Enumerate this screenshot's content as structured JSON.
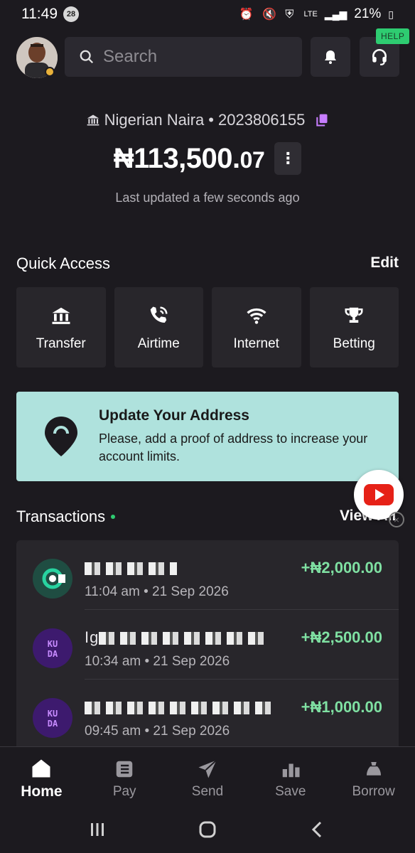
{
  "status_bar": {
    "time": "11:49",
    "notification_count": "28",
    "network": "LTE",
    "battery": "21%",
    "icons": [
      "alarm-icon",
      "mute-icon",
      "battery-saver-icon",
      "lte-icon",
      "signal-icon",
      "battery-icon"
    ]
  },
  "header": {
    "search_placeholder": "Search",
    "help_tag": "HELP"
  },
  "account": {
    "currency": "Nigerian Naira",
    "separator": "•",
    "number": "2023806155",
    "balance_main": "₦113,500.",
    "balance_decimal": "07",
    "more_label": "⋮",
    "last_updated": "Last updated a few seconds ago"
  },
  "quick_access": {
    "title": "Quick Access",
    "edit_label": "Edit",
    "items": [
      {
        "label": "Transfer",
        "icon": "bank-icon"
      },
      {
        "label": "Airtime",
        "icon": "phone-icon"
      },
      {
        "label": "Internet",
        "icon": "wifi-icon"
      },
      {
        "label": "Betting",
        "icon": "trophy-icon"
      }
    ]
  },
  "banner": {
    "title": "Update Your Address",
    "description": "Please, add a proof of address to increase your account limits.",
    "icon": "location-pin-icon",
    "background": "#afe2dd"
  },
  "transactions": {
    "title": "Transactions",
    "view_all_label": "View All",
    "items": [
      {
        "name_visible": "",
        "time": "11:04 am • 21 Sep 2026",
        "amount": "+₦2,000.00",
        "logo": "opay-logo"
      },
      {
        "name_visible": "Ig",
        "time": "10:34 am • 21 Sep 2026",
        "amount": "+₦2,500.00",
        "logo": "kuda-logo"
      },
      {
        "name_visible": "",
        "time": "09:45 am • 21 Sep 2026",
        "amount": "+₦1,000.00",
        "logo": "kuda-logo"
      }
    ],
    "amount_color": "#7fe0a2"
  },
  "bottom_nav": {
    "items": [
      {
        "label": "Home",
        "icon": "home-icon",
        "active": true
      },
      {
        "label": "Pay",
        "icon": "pay-icon",
        "active": false
      },
      {
        "label": "Send",
        "icon": "send-icon",
        "active": false
      },
      {
        "label": "Save",
        "icon": "save-icon",
        "active": false
      },
      {
        "label": "Borrow",
        "icon": "borrow-icon",
        "active": false
      }
    ]
  },
  "colors": {
    "background": "#1c1a1f",
    "tile": "#28262b",
    "accent_green": "#2ecc71",
    "copy_purple": "#c77dff"
  }
}
